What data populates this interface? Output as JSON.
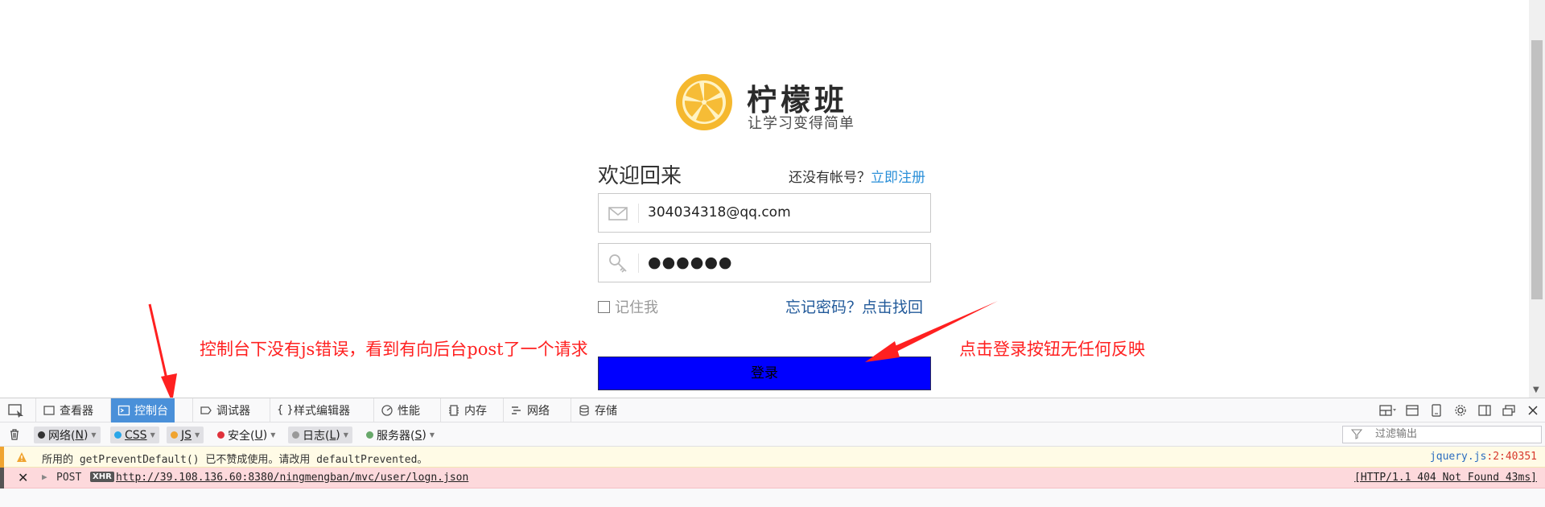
{
  "brand": {
    "name": "柠檬班",
    "slogan": "让学习变得简单",
    "logo_color": "#f5b82e"
  },
  "login": {
    "welcome": "欢迎回来",
    "no_account": "还没有帐号？",
    "register_link": "立即注册",
    "email_value": "304034318@qq.com",
    "password_value": "●●●●●●",
    "remember_label": "记住我",
    "forgot_text": "忘记密码？点击找回",
    "login_button_label": "登录",
    "login_button_color": "#0000ff"
  },
  "annotations": {
    "left": "控制台下没有js错误，看到有向后台post了一个请求",
    "right": "点击登录按钮无任何反映",
    "color": "#ff2020"
  },
  "devtools": {
    "tabs": {
      "inspector": "查看器",
      "console": "控制台",
      "debugger": "调试器",
      "style_editor": "样式编辑器",
      "performance": "性能",
      "memory": "内存",
      "network": "网络",
      "storage": "存储"
    },
    "filters": {
      "net": "网络(",
      "net_key": "N",
      "css": "CSS",
      "js": "JS",
      "security": "安全(",
      "security_key": "U",
      "logging": "日志(",
      "logging_key": "L",
      "server": "服务器(",
      "server_key": "S"
    },
    "filter_placeholder": "过滤输出",
    "messages": {
      "warning_text": "所用的 getPreventDefault() 已不赞成使用。请改用 defaultPrevented。",
      "warning_source": "jquery.js",
      "warning_location": ":2:40351",
      "error_method": "POST",
      "error_badge": "XHR",
      "error_url": "http://39.108.136.60:8380/ningmengban/mvc/user/logn.json",
      "error_status": "[HTTP/1.1 404 Not Found 43ms]"
    }
  }
}
